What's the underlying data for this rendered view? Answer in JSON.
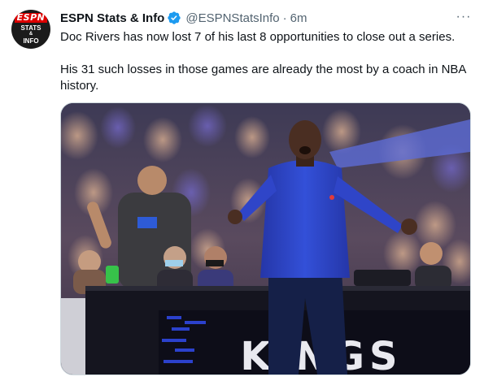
{
  "account": {
    "avatar_brand": "ESPN",
    "avatar_line1": "STATS",
    "avatar_line2": "&",
    "avatar_line3": "INFO",
    "display_name": "ESPN Stats & Info",
    "verified_icon": "verified-badge-icon",
    "handle": "@ESPNStatsInfo",
    "separator": "·",
    "timestamp": "6m"
  },
  "menu": {
    "icon": "more-horizontal-icon",
    "label": "···"
  },
  "tweet": {
    "paragraphs": [
      "Doc Rivers has now lost 7 of his last 8 opportunities to close out a series.",
      "His 31 such losses in those games are already the most by a coach in NBA history."
    ]
  },
  "media": {
    "type": "photo",
    "court_banner_text": "KINGS"
  },
  "colors": {
    "text": "#0f1419",
    "secondary": "#536471",
    "verified": "#1d9bf0",
    "jacket": "#2f45c8"
  }
}
